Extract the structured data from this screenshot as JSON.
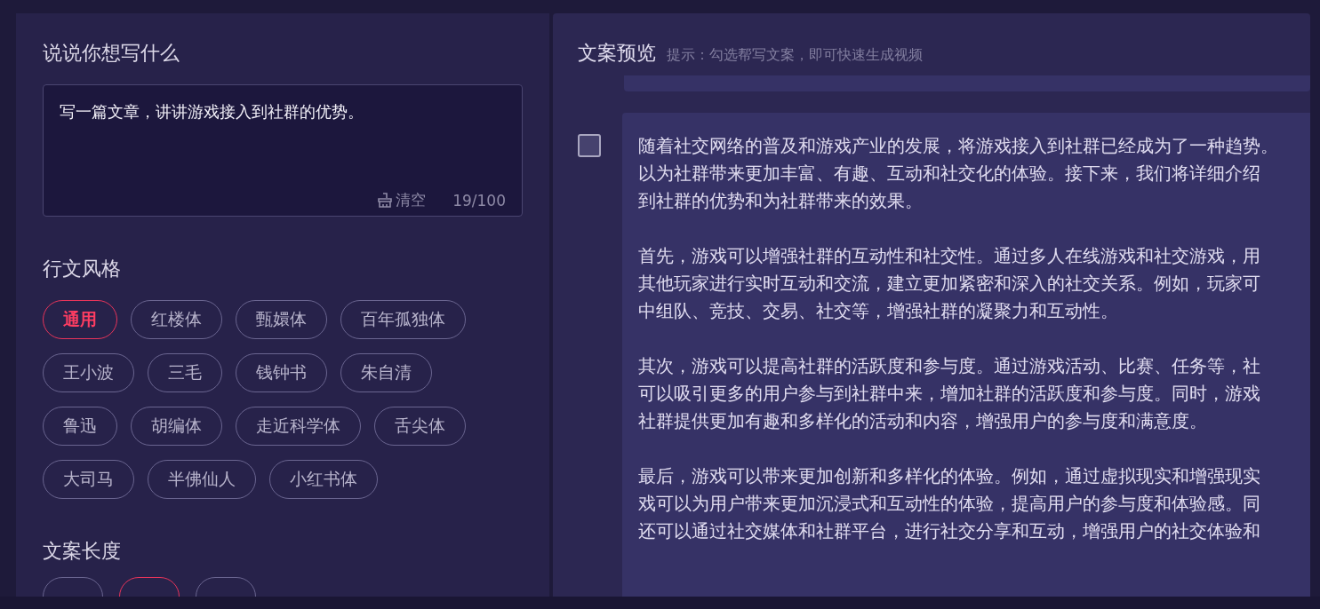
{
  "left_panel": {
    "prompt_section": {
      "title": "说说你想写什么",
      "input": {
        "value": "写一篇文章，讲讲游戏接入到社群的优势。",
        "clear_label": "清空",
        "counter": "19/100"
      }
    },
    "style_section": {
      "title": "行文风格",
      "options": [
        {
          "label": "通用",
          "selected": true
        },
        {
          "label": "红楼体",
          "selected": false
        },
        {
          "label": "甄嬛体",
          "selected": false
        },
        {
          "label": "百年孤独体",
          "selected": false
        },
        {
          "label": "王小波",
          "selected": false
        },
        {
          "label": "三毛",
          "selected": false
        },
        {
          "label": "钱钟书",
          "selected": false
        },
        {
          "label": "朱自清",
          "selected": false
        },
        {
          "label": "鲁迅",
          "selected": false
        },
        {
          "label": "胡编体",
          "selected": false
        },
        {
          "label": "走近科学体",
          "selected": false
        },
        {
          "label": "舌尖体",
          "selected": false
        },
        {
          "label": "大司马",
          "selected": false
        },
        {
          "label": "半佛仙人",
          "selected": false
        },
        {
          "label": "小红书体",
          "selected": false
        }
      ]
    },
    "length_section": {
      "title": "文案长度",
      "options": [
        {
          "selected": false
        },
        {
          "selected": true
        },
        {
          "selected": false
        }
      ]
    }
  },
  "preview_panel": {
    "title": "文案预览",
    "hint": "提示：勾选帮写文案，即可快速生成视频",
    "drafts": [
      {
        "checked": false,
        "paragraphs": [
          [
            "随着社交网络的普及和游戏产业的发展，将游戏接入到社群已经成为了一种趋势。",
            "以为社群带来更加丰富、有趣、互动和社交化的体验。接下来，我们将详细介绍",
            "到社群的优势和为社群带来的效果。"
          ],
          [
            "首先，游戏可以增强社群的互动性和社交性。通过多人在线游戏和社交游戏，用",
            "其他玩家进行实时互动和交流，建立更加紧密和深入的社交关系。例如，玩家可",
            "中组队、竞技、交易、社交等，增强社群的凝聚力和互动性。"
          ],
          [
            "其次，游戏可以提高社群的活跃度和参与度。通过游戏活动、比赛、任务等，社",
            "可以吸引更多的用户参与到社群中来，增加社群的活跃度和参与度。同时，游戏",
            "社群提供更加有趣和多样化的活动和内容，增强用户的参与度和满意度。"
          ],
          [
            "最后，游戏可以带来更加创新和多样化的体验。例如，通过虚拟现实和增强现实",
            "戏可以为用户带来更加沉浸式和互动性的体验，提高用户的参与度和体验感。同",
            "还可以通过社交媒体和社群平台，进行社交分享和互动，增强用户的社交体验和"
          ]
        ]
      }
    ]
  }
}
